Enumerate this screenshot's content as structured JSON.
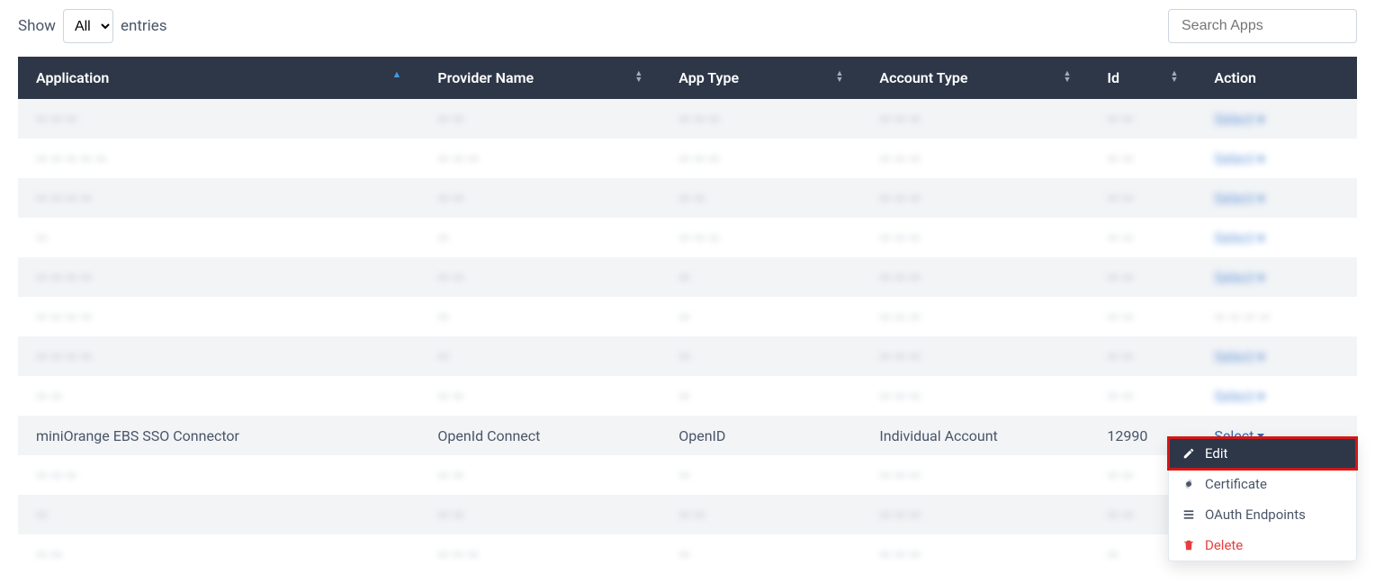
{
  "top": {
    "show_label_before": "Show",
    "entries_option": "All",
    "show_label_after": "entries",
    "search_placeholder": "Search Apps"
  },
  "columns": {
    "application": "Application",
    "provider": "Provider Name",
    "app_type": "App Type",
    "account_type": "Account Type",
    "id": "Id",
    "action": "Action"
  },
  "rows": [
    {
      "application": "— — —",
      "provider": "— —",
      "app_type": "— — —",
      "account_type": "— — —",
      "id": "— —",
      "action": "Select ▾",
      "blurred": true
    },
    {
      "application": "— — — — —",
      "provider": "— — —",
      "app_type": "— — —",
      "account_type": "— — —",
      "id": "— —",
      "action": "Select ▾",
      "blurred": true
    },
    {
      "application": "— — — —",
      "provider": "— —",
      "app_type": "— —",
      "account_type": "— — —",
      "id": "— —",
      "action": "Select ▾",
      "blurred": true
    },
    {
      "application": "—",
      "provider": "—",
      "app_type": "— — —",
      "account_type": "— — —",
      "id": "— —",
      "action": "Select ▾",
      "blurred": true
    },
    {
      "application": "— — — —",
      "provider": "— —",
      "app_type": "—",
      "account_type": "— — —",
      "id": "— —",
      "action": "Select ▾",
      "blurred": true
    },
    {
      "application": "— — — —",
      "provider": "—",
      "app_type": "—",
      "account_type": "— — —",
      "id": "— —",
      "action": "— — — —",
      "blurred": true,
      "blur4": true
    },
    {
      "application": "— — — —",
      "provider": "—",
      "app_type": "—",
      "account_type": "— — —",
      "id": "— —",
      "action": "Select ▾",
      "blurred": true
    },
    {
      "application": "— —",
      "provider": "— —",
      "app_type": "—",
      "account_type": "— — —",
      "id": "— —",
      "action": "Select ▾",
      "blurred": true
    },
    {
      "application": "miniOrange EBS SSO Connector",
      "provider": "OpenId Connect",
      "app_type": "OpenID",
      "account_type": "Individual Account",
      "id": "12990",
      "action": "Select",
      "blurred": false,
      "dropdown": true
    },
    {
      "application": "— — —",
      "provider": "— —",
      "app_type": "—",
      "account_type": "— — —",
      "id": "— —",
      "action": "",
      "blurred": true
    },
    {
      "application": "—",
      "provider": "— —",
      "app_type": "— —",
      "account_type": "— — —",
      "id": "— —",
      "action": "",
      "blurred": true
    },
    {
      "application": "— —",
      "provider": "— — —",
      "app_type": "—",
      "account_type": "— — —",
      "id": "—",
      "action": "",
      "blurred": true
    }
  ],
  "dropdown": {
    "edit": "Edit",
    "certificate": "Certificate",
    "oauth": "OAuth Endpoints",
    "delete": "Delete"
  }
}
